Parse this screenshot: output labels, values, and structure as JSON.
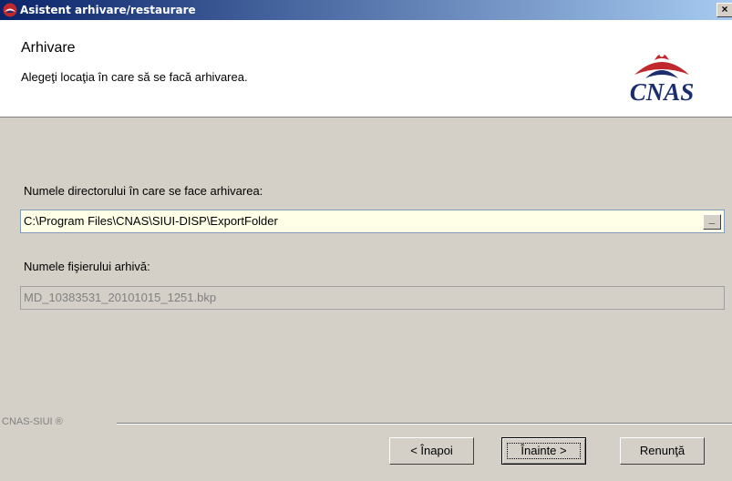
{
  "window": {
    "title": "Asistent arhivare/restaurare",
    "close_label": "×"
  },
  "header": {
    "title": "Arhivare",
    "subtitle": "Alegeţi locaţia în care să se facă arhivarea.",
    "logo_text": "CNAS"
  },
  "form": {
    "dir_label": "Numele directorului în care se face arhivarea:",
    "dir_value": "C:\\Program Files\\CNAS\\SIUI-DISP\\ExportFolder",
    "browse_label": "_",
    "file_label": "Numele fişierului arhivă:",
    "file_value": "MD_10383531_20101015_1251.bkp"
  },
  "footer": {
    "brand": "CNAS-SIUI ®"
  },
  "buttons": {
    "back_label": "< Înapoi",
    "next_label": "Înainte >",
    "cancel_label": "Renunţă"
  },
  "colors": {
    "titlebar_start": "#0a246a",
    "titlebar_end": "#a6caf0",
    "logo_red": "#c0282d",
    "logo_blue": "#1b2f6e",
    "input_bg": "#ffffe8"
  }
}
